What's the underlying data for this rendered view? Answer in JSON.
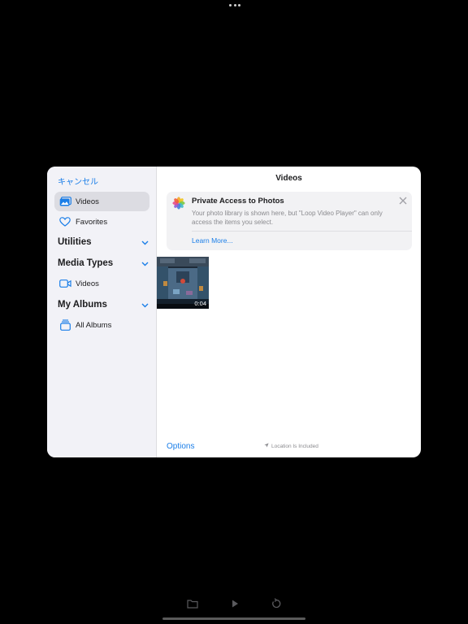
{
  "sheet": {
    "title": "Videos",
    "cancel_label": "キャンセル",
    "options_label": "Options",
    "location_note": "Location Is Included"
  },
  "sidebar": {
    "items": [
      {
        "label": "Videos",
        "icon": "photo-library-icon",
        "selected": true
      },
      {
        "label": "Favorites",
        "icon": "heart-icon",
        "selected": false
      }
    ],
    "sections": [
      {
        "title": "Utilities",
        "items": []
      },
      {
        "title": "Media Types",
        "items": [
          {
            "label": "Videos",
            "icon": "video-camera-icon"
          }
        ]
      },
      {
        "title": "My Albums",
        "items": [
          {
            "label": "All Albums",
            "icon": "albums-stack-icon"
          }
        ]
      }
    ]
  },
  "banner": {
    "title": "Private Access to Photos",
    "text": "Your photo library is shown here, but \"Loop Video Player\" can only access the items you select.",
    "link_label": "Learn More..."
  },
  "grid": {
    "videos": [
      {
        "duration": "0:04"
      }
    ]
  },
  "colors": {
    "accent": "#1a7ee8",
    "sidebar_bg": "#f2f2f7",
    "background": "#000000"
  }
}
